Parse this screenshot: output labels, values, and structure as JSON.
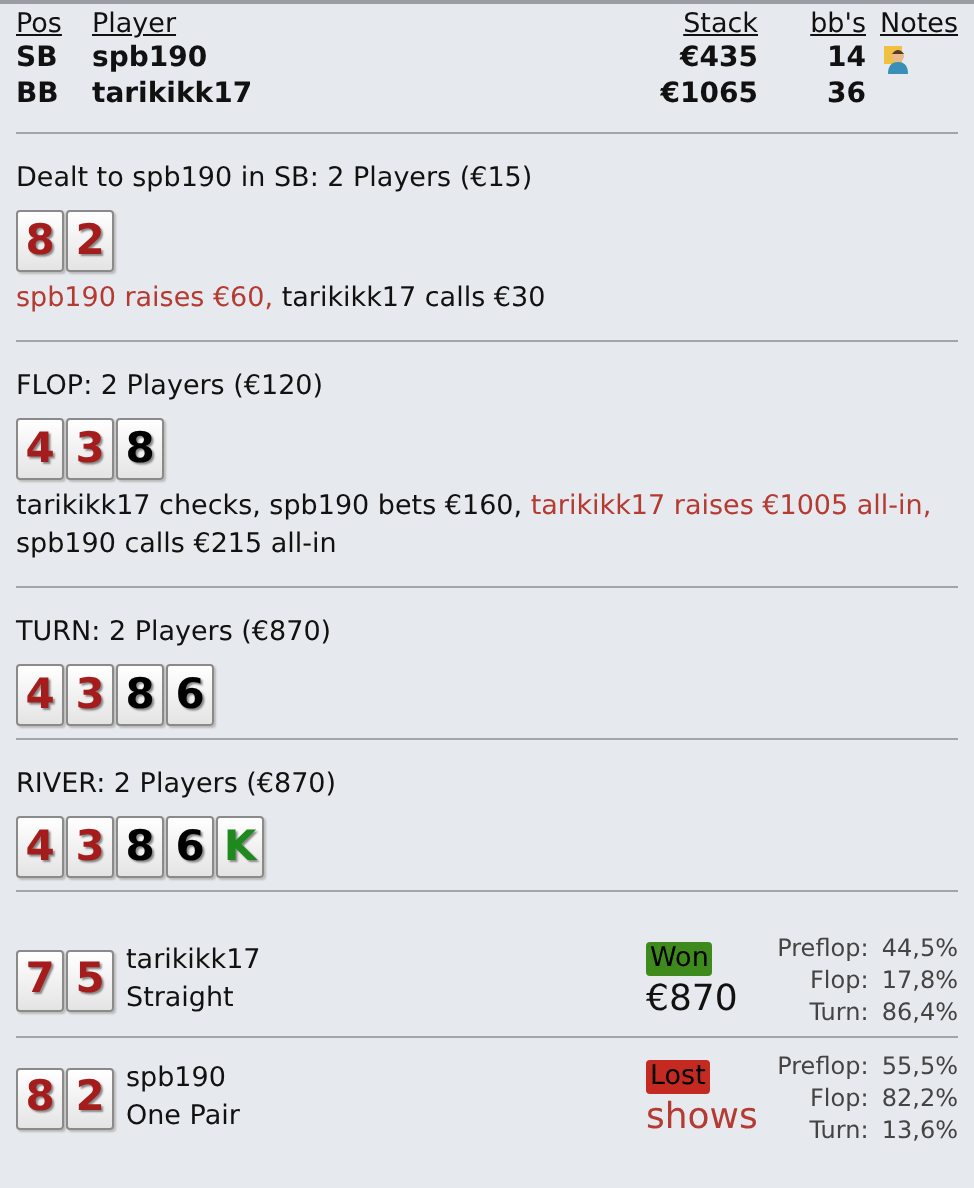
{
  "players_table": {
    "columns": [
      "Pos",
      "Player",
      "Stack",
      "bb's",
      "Notes"
    ],
    "rows": [
      {
        "pos": "SB",
        "player": "spb190",
        "stack": "€435",
        "bbs": "14",
        "has_notes": true
      },
      {
        "pos": "BB",
        "player": "tarikikk17",
        "stack": "€1065",
        "bbs": "36",
        "has_notes": false
      }
    ]
  },
  "streets": [
    {
      "heading": "Dealt to spb190 in SB: 2 Players (€15)",
      "cards": [
        {
          "rank": "8",
          "color": "#a51c1c"
        },
        {
          "rank": "2",
          "color": "#a51c1c"
        }
      ],
      "actions": [
        {
          "text": "spb190 raises €60,",
          "raise": true
        },
        {
          "text": "tarikikk17 calls €30",
          "raise": false
        }
      ]
    },
    {
      "heading": "FLOP: 2 Players (€120)",
      "cards": [
        {
          "rank": "4",
          "color": "#a51c1c"
        },
        {
          "rank": "3",
          "color": "#a51c1c"
        },
        {
          "rank": "8",
          "color": "#000000"
        }
      ],
      "actions": [
        {
          "text": "tarikikk17 checks, spb190 bets €160,",
          "raise": false
        },
        {
          "text": "tarikikk17 raises €1005 all-in,",
          "raise": true
        },
        {
          "text": "spb190 calls €215 all-in",
          "raise": false
        }
      ]
    },
    {
      "heading": "TURN: 2 Players (€870)",
      "cards": [
        {
          "rank": "4",
          "color": "#a51c1c"
        },
        {
          "rank": "3",
          "color": "#a51c1c"
        },
        {
          "rank": "8",
          "color": "#000000"
        },
        {
          "rank": "6",
          "color": "#000000"
        }
      ]
    },
    {
      "heading": "RIVER: 2 Players (€870)",
      "cards": [
        {
          "rank": "4",
          "color": "#a51c1c"
        },
        {
          "rank": "3",
          "color": "#a51c1c"
        },
        {
          "rank": "8",
          "color": "#000000"
        },
        {
          "rank": "6",
          "color": "#000000"
        },
        {
          "rank": "K",
          "color": "#1e8a1e"
        }
      ]
    }
  ],
  "results": [
    {
      "cards": [
        {
          "rank": "7",
          "color": "#a51c1c"
        },
        {
          "rank": "5",
          "color": "#a51c1c"
        }
      ],
      "player": "tarikikk17",
      "hand": "Straight",
      "kind": "won",
      "badge": "Won",
      "amount": "€870",
      "equity": [
        {
          "label": "Preflop:",
          "value": "44,5%"
        },
        {
          "label": "Flop:",
          "value": "17,8%"
        },
        {
          "label": "Turn:",
          "value": "86,4%"
        }
      ]
    },
    {
      "cards": [
        {
          "rank": "8",
          "color": "#a51c1c"
        },
        {
          "rank": "2",
          "color": "#a51c1c"
        }
      ],
      "player": "spb190",
      "hand": "One Pair",
      "kind": "lost",
      "badge": "Lost",
      "amount": "shows",
      "equity": [
        {
          "label": "Preflop:",
          "value": "55,5%"
        },
        {
          "label": "Flop:",
          "value": "82,2%"
        },
        {
          "label": "Turn:",
          "value": "13,6%"
        }
      ]
    }
  ]
}
